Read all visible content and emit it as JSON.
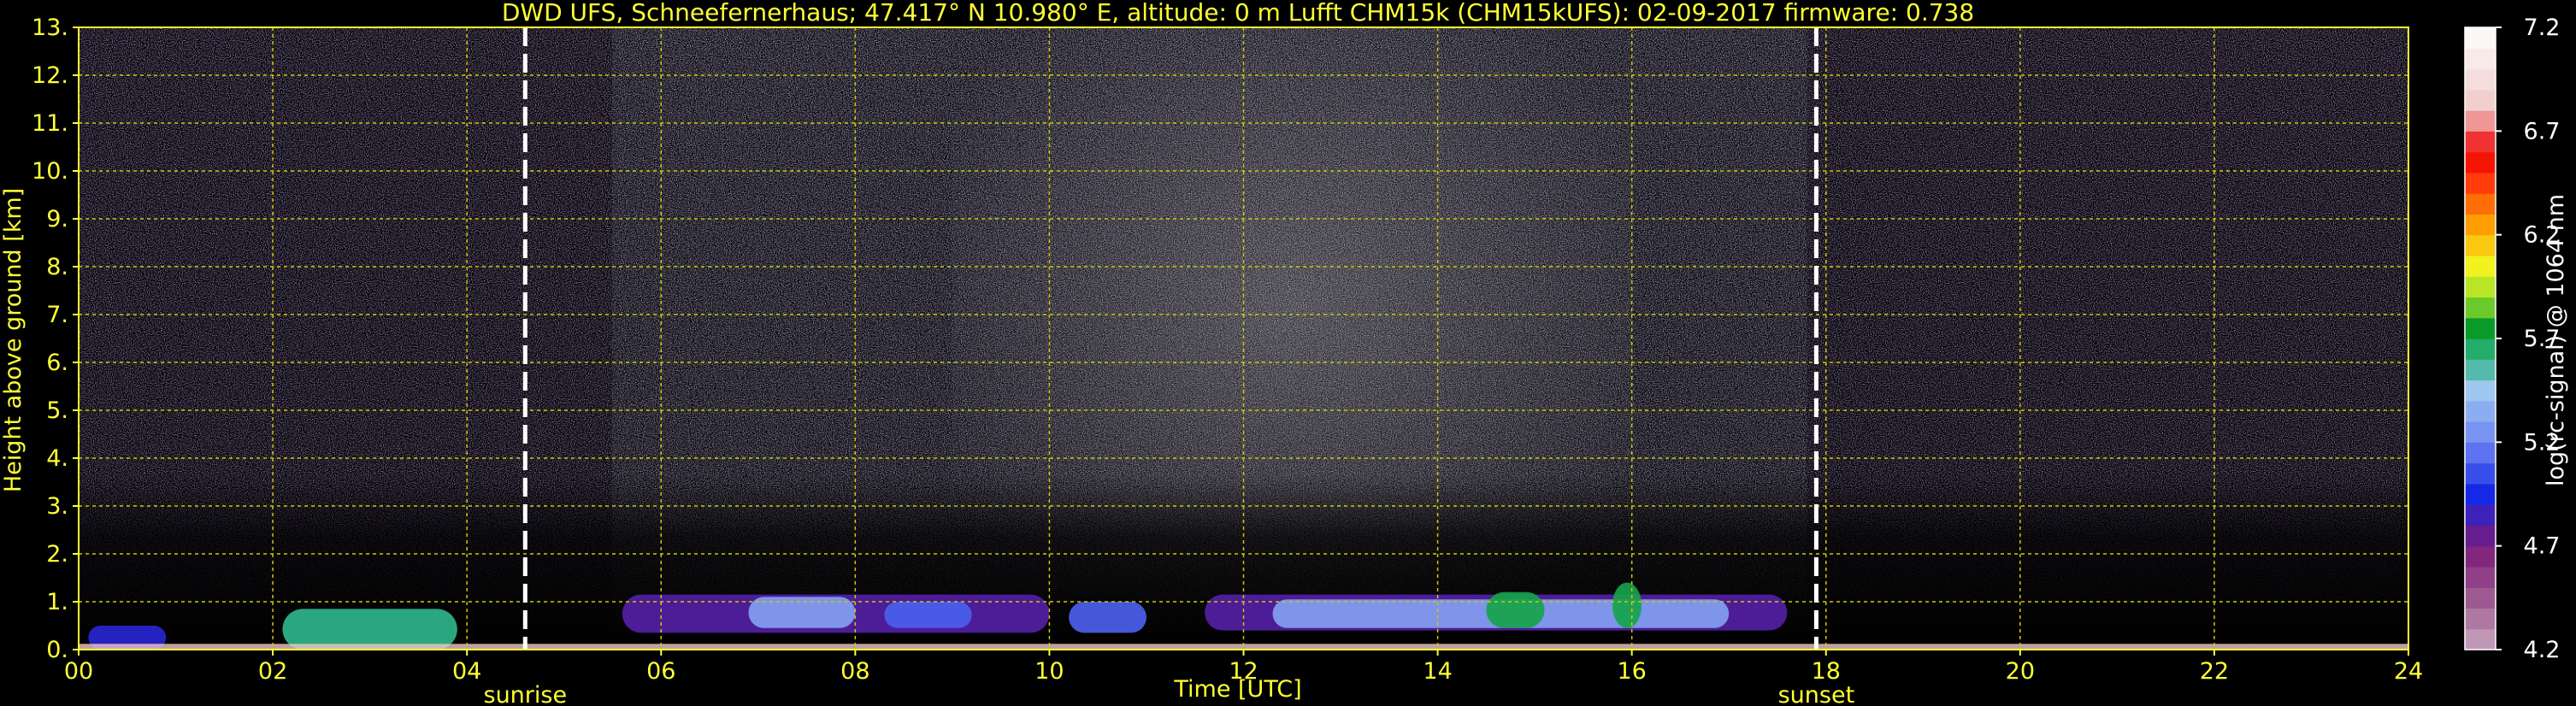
{
  "chart_data": {
    "type": "heatmap",
    "title": "DWD UFS, Schneefernerhaus; 47.417° N 10.980° E, altitude: 0 m    Lufft CHM15k (CHM15kUFS): 02-09-2017    firmware: 0.738",
    "xlabel": "Time [UTC]",
    "ylabel": "Height above ground [km]",
    "xlim": [
      0,
      24
    ],
    "ylim": [
      0,
      13
    ],
    "x_ticks": [
      "00",
      "02",
      "04",
      "06",
      "08",
      "10",
      "12",
      "14",
      "16",
      "18",
      "20",
      "22",
      "24"
    ],
    "y_ticks": [
      "0.",
      "1.",
      "2.",
      "3.",
      "4.",
      "5.",
      "6.",
      "7.",
      "8.",
      "9.",
      "10.",
      "11.",
      "12.",
      "13."
    ],
    "grid": true,
    "events": [
      {
        "label": "sunrise",
        "time": 4.6
      },
      {
        "label": "sunset",
        "time": 17.9
      }
    ],
    "colorbar": {
      "label": "log(rc-signal) @ 1064 nm",
      "range": [
        4.2,
        7.2
      ],
      "ticks": [
        "4.2",
        "4.7",
        "5.2",
        "5.7",
        "6.2",
        "6.7",
        "7.2"
      ]
    },
    "cloud_layers": [
      {
        "t_start": 0.1,
        "t_end": 0.9,
        "h_bottom": 0.0,
        "h_top": 0.5,
        "level": 4.9
      },
      {
        "t_start": 2.1,
        "t_end": 3.9,
        "h_bottom": 0.0,
        "h_top": 0.85,
        "level": 5.6
      },
      {
        "t_start": 5.6,
        "t_end": 10.0,
        "h_bottom": 0.35,
        "h_top": 1.15,
        "level": 4.8
      },
      {
        "t_start": 6.9,
        "t_end": 8.0,
        "h_bottom": 0.45,
        "h_top": 1.1,
        "level": 5.3
      },
      {
        "t_start": 8.3,
        "t_end": 9.2,
        "h_bottom": 0.45,
        "h_top": 1.0,
        "level": 5.1
      },
      {
        "t_start": 10.2,
        "t_end": 11.0,
        "h_bottom": 0.35,
        "h_top": 1.0,
        "level": 5.1
      },
      {
        "t_start": 11.6,
        "t_end": 17.6,
        "h_bottom": 0.4,
        "h_top": 1.15,
        "level": 4.8
      },
      {
        "t_start": 12.3,
        "t_end": 17.0,
        "h_bottom": 0.45,
        "h_top": 1.05,
        "level": 5.3
      },
      {
        "t_start": 14.5,
        "t_end": 15.1,
        "h_bottom": 0.45,
        "h_top": 1.2,
        "level": 5.7
      },
      {
        "t_start": 15.8,
        "t_end": 16.1,
        "h_bottom": 0.45,
        "h_top": 1.4,
        "level": 5.7
      }
    ]
  }
}
